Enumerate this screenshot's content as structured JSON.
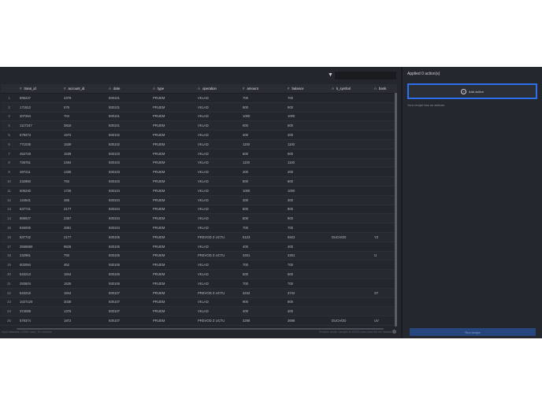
{
  "toolbar": {
    "filter_icon": "filter-icon",
    "search_value": ""
  },
  "table": {
    "columns": [
      {
        "icon": "#",
        "label": "trans_id"
      },
      {
        "icon": "#",
        "label": "account_id"
      },
      {
        "icon": "A",
        "label": "date"
      },
      {
        "icon": "A",
        "label": "type"
      },
      {
        "icon": "A",
        "label": "operation"
      },
      {
        "icon": "#",
        "label": "amount"
      },
      {
        "icon": "#",
        "label": "balance"
      },
      {
        "icon": "A",
        "label": "k_symbol"
      },
      {
        "icon": "A",
        "label": "bank"
      }
    ],
    "rows": [
      [
        "1",
        "695247",
        "2378",
        "930101",
        "PRIJEM",
        "VKLAD",
        "700",
        "700",
        "",
        ""
      ],
      [
        "2",
        "171812",
        "576",
        "930101",
        "PRIJEM",
        "VKLAD",
        "900",
        "900",
        "",
        ""
      ],
      [
        "3",
        "207264",
        "704",
        "930101",
        "PRIJEM",
        "VKLAD",
        "1000",
        "1000",
        "",
        ""
      ],
      [
        "4",
        "1117247",
        "3818",
        "930101",
        "PRIJEM",
        "VKLAD",
        "600",
        "600",
        "",
        ""
      ],
      [
        "5",
        "579373",
        "1972",
        "930102",
        "PRIJEM",
        "VKLAD",
        "400",
        "400",
        "",
        ""
      ],
      [
        "6",
        "771035",
        "1539",
        "930102",
        "PRIJEM",
        "VKLAD",
        "1100",
        "1100",
        "",
        ""
      ],
      [
        "7",
        "452728",
        "1539",
        "930103",
        "PRIJEM",
        "VKLAD",
        "600",
        "600",
        "",
        ""
      ],
      [
        "8",
        "725751",
        "2484",
        "930103",
        "PRIJEM",
        "VKLAD",
        "1100",
        "1100",
        "",
        ""
      ],
      [
        "9",
        "497211",
        "1335",
        "930103",
        "PRIJEM",
        "VKLAD",
        "200",
        "200",
        "",
        ""
      ],
      [
        "10",
        "232960",
        "793",
        "930103",
        "PRIJEM",
        "VKLAD",
        "800",
        "800",
        "",
        ""
      ],
      [
        "11",
        "505240",
        "1726",
        "930104",
        "PRIJEM",
        "VKLAD",
        "1000",
        "1000",
        "",
        ""
      ],
      [
        "12",
        "144541",
        "485",
        "930104",
        "PRIJEM",
        "VKLAD",
        "300",
        "300",
        "",
        ""
      ],
      [
        "13",
        "637741",
        "2177",
        "930104",
        "PRIJEM",
        "VKLAD",
        "800",
        "800",
        "",
        ""
      ],
      [
        "14",
        "869927",
        "2357",
        "930104",
        "PRIJEM",
        "VKLAD",
        "800",
        "800",
        "",
        ""
      ],
      [
        "15",
        "846006",
        "2881",
        "930104",
        "PRIJEM",
        "VKLAD",
        "700",
        "700",
        "",
        ""
      ],
      [
        "16",
        "637742",
        "2177",
        "930105",
        "PRIJEM",
        "PREVOD Z UCTU",
        "5123",
        "5923",
        "DUCHOD",
        "YZ"
      ],
      [
        "17",
        "3566680",
        "9626",
        "930105",
        "PRIJEM",
        "VKLAD",
        "400",
        "400",
        "",
        ""
      ],
      [
        "18",
        "232961",
        "793",
        "930105",
        "PRIJEM",
        "PREVOD Z UCTU",
        "3401",
        "4201",
        "",
        "IJ"
      ],
      [
        "19",
        "502094",
        "452",
        "930106",
        "PRIJEM",
        "VKLAD",
        "700",
        "700",
        "",
        ""
      ],
      [
        "20",
        "543213",
        "1844",
        "930106",
        "PRIJEM",
        "VKLAD",
        "500",
        "500",
        "",
        ""
      ],
      [
        "21",
        "293604",
        "1626",
        "930106",
        "PRIJEM",
        "VKLAD",
        "700",
        "700",
        "",
        ""
      ],
      [
        "22",
        "543216",
        "1844",
        "930107",
        "PRIJEM",
        "PREVOD Z UCTU",
        "3242",
        "3742",
        "",
        "ST"
      ],
      [
        "23",
        "1027120",
        "3038",
        "930107",
        "PRIJEM",
        "VKLAD",
        "900",
        "900",
        "",
        ""
      ],
      [
        "24",
        "374089",
        "1376",
        "930107",
        "PRIJEM",
        "VKLAD",
        "400",
        "400",
        "",
        ""
      ],
      [
        "25",
        "579374",
        "1972",
        "930107",
        "PRIJEM",
        "PREVOD Z UCTU",
        "3298",
        "3698",
        "DUCHOD",
        "UV"
      ]
    ]
  },
  "status": {
    "left": "Input datasets: 10000 rows, 10 columns",
    "right": "Preview mode: sample of 10000 rows from the full dataset"
  },
  "help_label": "?",
  "panel": {
    "title": "Applied 0 action(s)",
    "add_action_label": "Add action",
    "plus_glyph": "+",
    "no_actions_text": "Your recipe has no actions.",
    "run_label": "Run recipe"
  }
}
